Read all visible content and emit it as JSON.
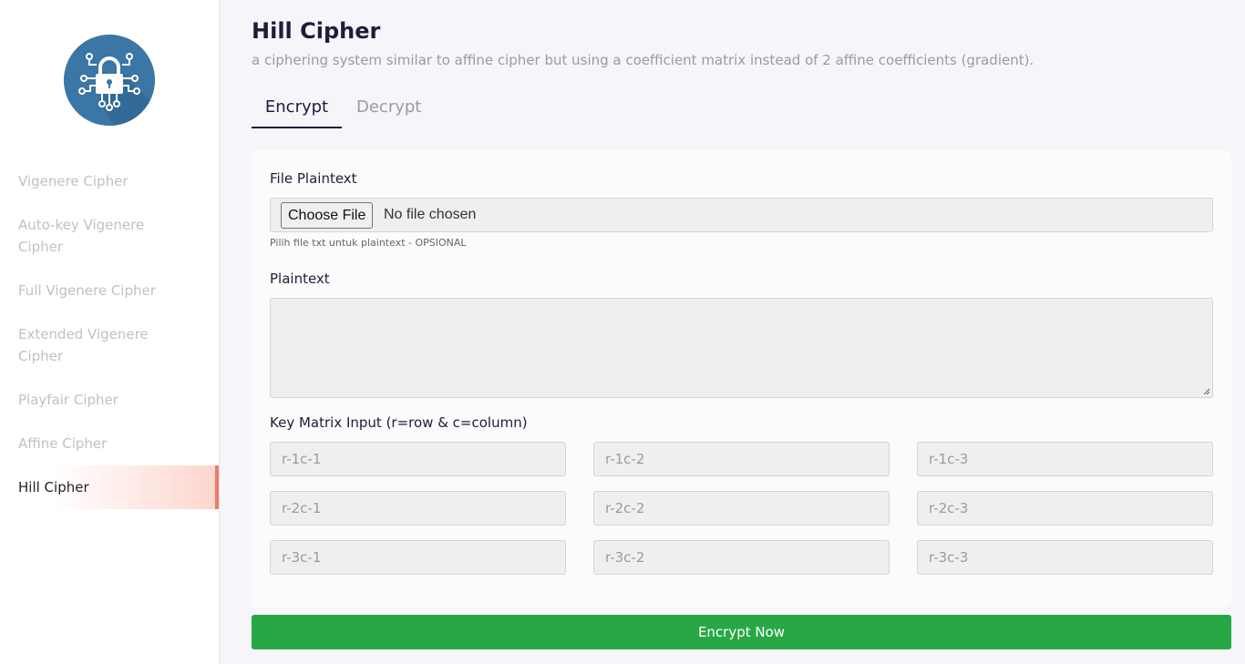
{
  "sidebar": {
    "logo_icon": "padlock-circuit-icon",
    "items": [
      {
        "label": "Vigenere Cipher"
      },
      {
        "label": "Auto-key Vigenere Cipher"
      },
      {
        "label": "Full Vigenere Cipher"
      },
      {
        "label": "Extended Vigenere Cipher"
      },
      {
        "label": "Playfair Cipher"
      },
      {
        "label": "Affine Cipher"
      },
      {
        "label": "Hill Cipher",
        "active": true
      }
    ],
    "accent_color": "#f07a66"
  },
  "page": {
    "title": "Hill Cipher",
    "subtitle": "a ciphering system similar to affine cipher but using a coefficient matrix instead of 2 affine coefficients (gradient)."
  },
  "tabs": [
    {
      "label": "Encrypt",
      "active": true
    },
    {
      "label": "Decrypt",
      "active": false
    }
  ],
  "form": {
    "file_label": "File Plaintext",
    "file_button": "Choose File",
    "file_status": "No file chosen",
    "file_help": "Pilih file txt untuk plaintext - OPSIONAL",
    "plaintext_label": "Plaintext",
    "plaintext_value": "",
    "matrix_label": "Key Matrix Input (r=row & c=column)",
    "matrix": [
      [
        "r-1c-1",
        "r-1c-2",
        "r-1c-3"
      ],
      [
        "r-2c-1",
        "r-2c-2",
        "r-2c-3"
      ],
      [
        "r-3c-1",
        "r-3c-2",
        "r-3c-3"
      ]
    ]
  },
  "submit": {
    "label": "Encrypt Now",
    "color": "#28a745"
  }
}
